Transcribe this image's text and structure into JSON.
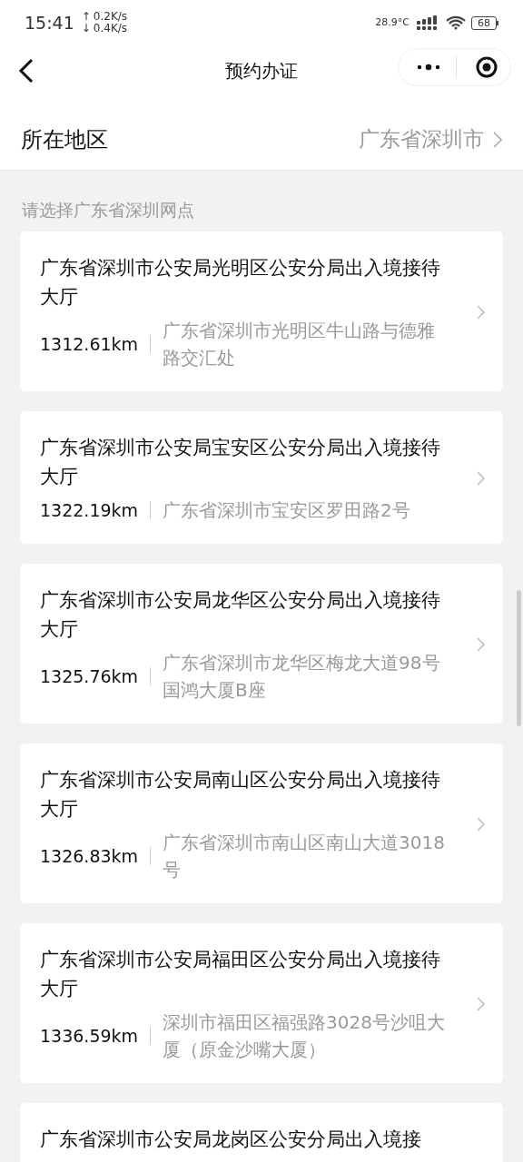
{
  "status_bar": {
    "time": "15:41",
    "upload": "↑",
    "upload_speed": "0.2K/s",
    "download": "↓",
    "download_speed": "0.4K/s",
    "temperature": "28.9°C",
    "battery": "68"
  },
  "nav": {
    "title": "预约办证"
  },
  "region": {
    "label": "所在地区",
    "value": "广东省深圳市"
  },
  "section_label": "请选择广东省深圳网点",
  "offices": [
    {
      "name": "广东省深圳市公安局光明区公安分局出入境接待大厅",
      "distance": "1312.61km",
      "address": "广东省深圳市光明区牛山路与德雅路交汇处"
    },
    {
      "name": "广东省深圳市公安局宝安区公安分局出入境接待大厅",
      "distance": "1322.19km",
      "address": "广东省深圳市宝安区罗田路2号"
    },
    {
      "name": "广东省深圳市公安局龙华区公安分局出入境接待大厅",
      "distance": "1325.76km",
      "address": "广东省深圳市龙华区梅龙大道98号国鸿大厦B座"
    },
    {
      "name": "广东省深圳市公安局南山区公安分局出入境接待大厅",
      "distance": "1326.83km",
      "address": "广东省深圳市南山区南山大道3018号"
    },
    {
      "name": "广东省深圳市公安局福田区公安分局出入境接待大厅",
      "distance": "1336.59km",
      "address": "深圳市福田区福强路3028号沙咀大厦（原金沙嘴大厦）"
    },
    {
      "name": "广东省深圳市公安局龙岗区公安分局出入境接"
    }
  ]
}
